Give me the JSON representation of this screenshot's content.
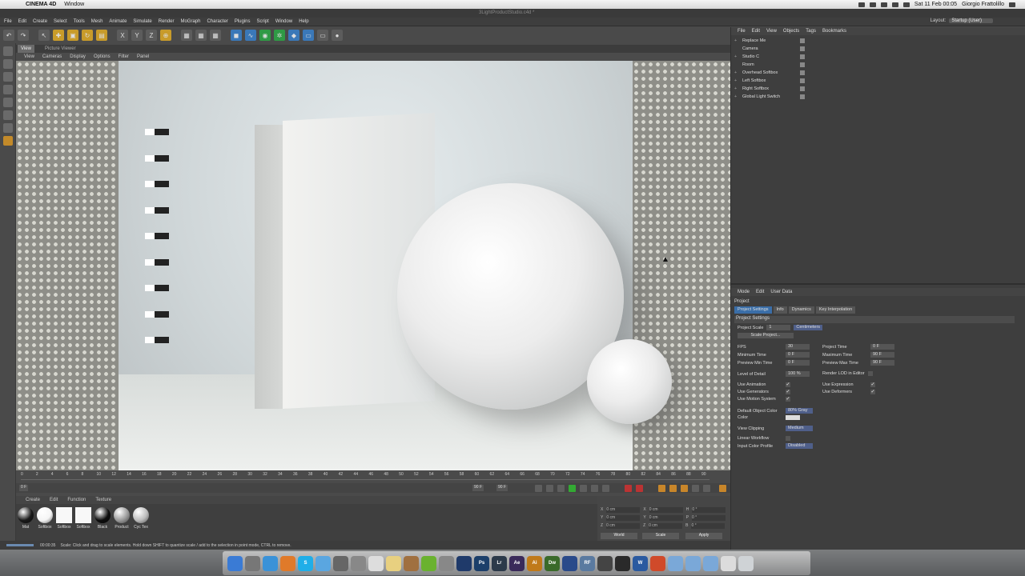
{
  "mac": {
    "app": "CINEMA 4D",
    "menu": "Window",
    "title": "3LightProductStudio.c4d *",
    "date": "Sat 11 Feb 00:05",
    "user": "Giorgio Frattolillo"
  },
  "menu": [
    "File",
    "Edit",
    "Create",
    "Select",
    "Tools",
    "Mesh",
    "Animate",
    "Simulate",
    "Render",
    "MoGraph",
    "Character",
    "Plugins",
    "Script",
    "Window",
    "Help"
  ],
  "layout": {
    "label": "Layout:",
    "value": "Startup (User)"
  },
  "viewport": {
    "tab": "View",
    "tab2": "Picture Viewer",
    "menu": [
      "View",
      "Cameras",
      "Display",
      "Options",
      "Filter",
      "Panel"
    ]
  },
  "timeline": {
    "ticks": [
      "0",
      "2",
      "4",
      "6",
      "8",
      "10",
      "12",
      "14",
      "16",
      "18",
      "20",
      "22",
      "24",
      "26",
      "28",
      "30",
      "32",
      "34",
      "36",
      "38",
      "40",
      "42",
      "44",
      "46",
      "48",
      "50",
      "52",
      "54",
      "56",
      "58",
      "60",
      "62",
      "64",
      "66",
      "68",
      "70",
      "72",
      "74",
      "76",
      "78",
      "80",
      "82",
      "84",
      "86",
      "88",
      "90"
    ],
    "current": "0 F",
    "start": "0 F",
    "end_left": "90 F",
    "end": "90 F",
    "frame_right": "0 F"
  },
  "materials": {
    "menu": [
      "Create",
      "Edit",
      "Function",
      "Texture"
    ],
    "items": [
      {
        "label": "Mat",
        "color": "#1a1a1a"
      },
      {
        "label": "Softbox",
        "color": "#f5f5f5"
      },
      {
        "label": "Softbox",
        "color": "#f8f8f8"
      },
      {
        "label": "Softbox",
        "color": "#f8f8f8"
      },
      {
        "label": "Black",
        "color": "#0d0d0d"
      },
      {
        "label": "Product",
        "color": "#9a9a9a"
      },
      {
        "label": "Cyc Tex",
        "color": "#bcbcbc"
      }
    ]
  },
  "coords": {
    "rows": [
      {
        "a": "X",
        "av": "0 cm",
        "b": "X",
        "bv": "0 cm",
        "c": "H",
        "cv": "0 °"
      },
      {
        "a": "Y",
        "av": "0 cm",
        "b": "Y",
        "bv": "0 cm",
        "c": "P",
        "cv": "0 °"
      },
      {
        "a": "Z",
        "av": "0 cm",
        "b": "Z",
        "bv": "0 cm",
        "c": "B",
        "cv": "0 °"
      }
    ],
    "world": "World",
    "scale": "Scale",
    "apply": "Apply"
  },
  "status": {
    "time": "00:00:35",
    "text": "Scale: Click and drag to scale elements. Hold down SHIFT to quantize scale / add to the selection in point mode, CTRL to remove."
  },
  "objects": {
    "menu": [
      "File",
      "Edit",
      "View",
      "Objects",
      "Tags",
      "Bookmarks"
    ],
    "items": [
      "Replace Me",
      "Camera",
      "Studio C",
      "Room",
      "Overhead Softbox",
      "Left Softbox",
      "Right Softbox",
      "Global Light Switch"
    ]
  },
  "attributes": {
    "menu": [
      "Mode",
      "Edit",
      "User Data"
    ],
    "header": "Project",
    "tabs": [
      "Project Settings",
      "Info",
      "Dynamics",
      "Key Interpolation"
    ],
    "section": "Project Settings",
    "project_scale": {
      "label": "Project Scale",
      "value": "1",
      "unit": "Centimeters"
    },
    "scale_project": "Scale Project...",
    "fps": {
      "label": "FPS",
      "value": "30"
    },
    "project_time": {
      "label": "Project Time",
      "value": "0 F"
    },
    "min_time": {
      "label": "Minimum Time",
      "value": "0 F"
    },
    "max_time": {
      "label": "Maximum Time",
      "value": "90 F"
    },
    "prev_min": {
      "label": "Preview Min Time",
      "value": "0 F"
    },
    "prev_max": {
      "label": "Preview Max Time",
      "value": "90 F"
    },
    "lod": {
      "label": "Level of Detail",
      "value": "100 %"
    },
    "render_lod": "Render LOD in Editor",
    "use_anim": "Use Animation",
    "use_expr": "Use Expression",
    "use_gen": "Use Generators",
    "use_def": "Use Deformers",
    "use_motion": "Use Motion System",
    "def_color": {
      "label": "Default Object Color",
      "value": "80% Gray"
    },
    "color": "Color",
    "view_clip": {
      "label": "View Clipping",
      "value": "Medium"
    },
    "linear": "Linear Workflow",
    "input_profile": {
      "label": "Input Color Profile",
      "value": "Disabled"
    }
  },
  "dock": [
    {
      "name": "finder-icon",
      "label": "",
      "color": "#3a7bd5"
    },
    {
      "name": "launchpad-icon",
      "label": "",
      "color": "#777"
    },
    {
      "name": "safari-icon",
      "label": "",
      "color": "#3a92d8"
    },
    {
      "name": "firefox-icon",
      "label": "",
      "color": "#e07a2a"
    },
    {
      "name": "skype-icon",
      "label": "S",
      "color": "#1faee8"
    },
    {
      "name": "mail-icon",
      "label": "",
      "color": "#5aa6e0"
    },
    {
      "name": "settings-icon",
      "label": "",
      "color": "#666"
    },
    {
      "name": "system-prefs-icon",
      "label": "",
      "color": "#888"
    },
    {
      "name": "textedit-icon",
      "label": "",
      "color": "#ddd"
    },
    {
      "name": "notes-icon",
      "label": "",
      "color": "#e8d080"
    },
    {
      "name": "photo-icon",
      "label": "",
      "color": "#a07040"
    },
    {
      "name": "spotify-icon",
      "label": "",
      "color": "#6ab22f"
    },
    {
      "name": "printer-icon",
      "label": "",
      "color": "#888"
    },
    {
      "name": "quicktime-icon",
      "label": "",
      "color": "#1f3a6a"
    },
    {
      "name": "photoshop-icon",
      "label": "Ps",
      "color": "#1c3f6a"
    },
    {
      "name": "lightroom-icon",
      "label": "Lr",
      "color": "#2c3a4a"
    },
    {
      "name": "aftereffects-icon",
      "label": "Ae",
      "color": "#3a2a5a"
    },
    {
      "name": "illustrator-icon",
      "label": "Ai",
      "color": "#c07a1a"
    },
    {
      "name": "dreamweaver-icon",
      "label": "Dw",
      "color": "#3a6a2a"
    },
    {
      "name": "cinema4d-icon",
      "label": "",
      "color": "#2a4a8a"
    },
    {
      "name": "realflow-icon",
      "label": "RF",
      "color": "#5a7aa0"
    },
    {
      "name": "app-icon",
      "label": "",
      "color": "#444"
    },
    {
      "name": "app2-icon",
      "label": "",
      "color": "#2a2a2a"
    },
    {
      "name": "word-icon",
      "label": "W",
      "color": "#2a5aa0"
    },
    {
      "name": "app3-icon",
      "label": "",
      "color": "#d04a2a"
    },
    {
      "name": "folder-icon",
      "label": "",
      "color": "#7aa8d8"
    },
    {
      "name": "folder2-icon",
      "label": "",
      "color": "#7aa8d8"
    },
    {
      "name": "folder3-icon",
      "label": "",
      "color": "#7aa8d8"
    },
    {
      "name": "docs-icon",
      "label": "",
      "color": "#dcdcdc"
    },
    {
      "name": "trash-icon",
      "label": "",
      "color": "#cfd3d6"
    }
  ]
}
